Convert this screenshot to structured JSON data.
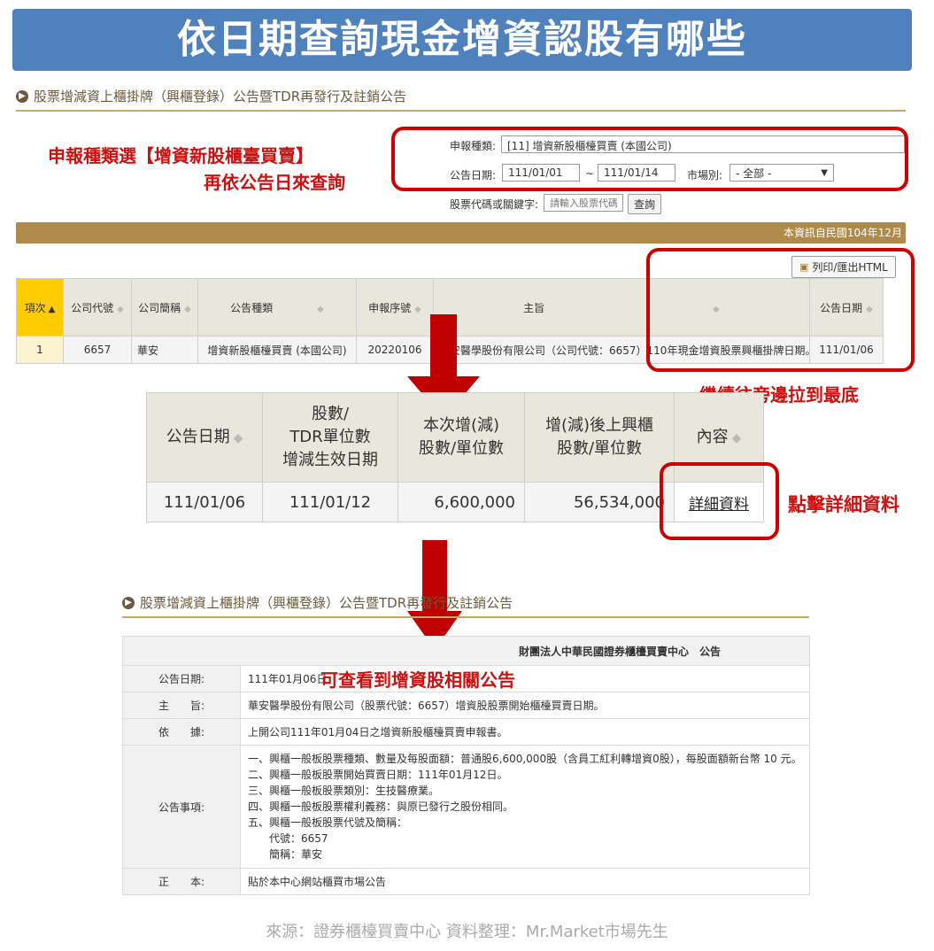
{
  "banner": {
    "title": "依日期查詢現金增資認股有哪些"
  },
  "section": {
    "title": "股票增減資上櫃掛牌（興櫃登錄）公告暨TDR再發行及註銷公告",
    "bullet": "▶"
  },
  "notes": {
    "select_type_line1": "申報種類選【增資新股櫃臺買賣】",
    "select_type_line2": "再依公告日來查詢",
    "scroll_right": "繼續往旁邊拉到最底",
    "click_detail": "點擊詳細資料",
    "view_announcement": "可查看到增資股相關公告"
  },
  "form": {
    "report_type_label": "申報種類:",
    "report_type_value": "[11] 增資新股櫃檯買賣 (本國公司)",
    "date_label": "公告日期:",
    "date_from": "111/01/01",
    "date_sep": "~",
    "date_to": "111/01/14",
    "market_label": "市場別:",
    "market_value": "- 全部 -",
    "keyword_label": "股票代碼或關鍵字:",
    "keyword_placeholder": "請輸入股票代碼",
    "search_button": "查詢"
  },
  "info_bar": {
    "text": "本資訊自民國104年12月"
  },
  "print_button": "列印/匯出HTML",
  "table1": {
    "headers": [
      "項次",
      "公司代號",
      "公司簡稱",
      "公告種類",
      "申報序號",
      "主旨",
      "公告日期"
    ],
    "row": [
      "1",
      "6657",
      "華安",
      "增資新股櫃檯買賣 (本國公司)",
      "20220106",
      "華安醫學股份有限公司（公司代號：6657）110年現金增資股票興櫃掛牌日期。",
      "111/01/06"
    ]
  },
  "table2": {
    "headers": [
      "公告日期",
      "股數/\nTDR單位數\n增減生效日期",
      "本次增(減)\n股數/單位數",
      "增(減)後上興櫃\n股數/單位數",
      "內容"
    ],
    "row": [
      "111/01/06",
      "111/01/12",
      "6,600,000",
      "56,534,000"
    ],
    "detail_link": "詳細資料"
  },
  "announcement": {
    "header": "財團法人中華民國證券櫃檯買賣中心　公告",
    "rows": [
      {
        "label": "公告日期:",
        "value": "111年01月06日"
      },
      {
        "label": "主　　旨:",
        "value": "華安醫學股份有限公司（股票代號：6657）增資股股票開始櫃檯買賣日期。"
      },
      {
        "label": "依　　據:",
        "value": "上開公司111年01月04日之增資新股櫃檯買賣申報書。"
      },
      {
        "label": "公告事項:",
        "lines": [
          "一、興櫃一般板股票種類、數量及每股面額：普通股6,600,000股（含員工紅利轉增資0股），每股面額新台幣 10 元。",
          "二、興櫃一般板股票開始買賣日期：111年01月12日。",
          "三、興櫃一般板股票類別：生技醫療業。",
          "四、興櫃一般板股票權利義務：與原已發行之股份相同。",
          "五、興櫃一般板股票代號及簡稱：",
          "　　代號：6657",
          "　　簡稱：華安"
        ]
      },
      {
        "label": "正　　本:",
        "value": "貼於本中心網站櫃買市場公告"
      }
    ]
  },
  "footer": {
    "source": "來源：證券櫃檯買賣中心  資料整理：Mr.Market市場先生"
  },
  "colors": {
    "banner": "#4f81bd",
    "accent_red": "#cc1111",
    "gold": "#b08a4a",
    "active_header": "#ffcc00"
  }
}
